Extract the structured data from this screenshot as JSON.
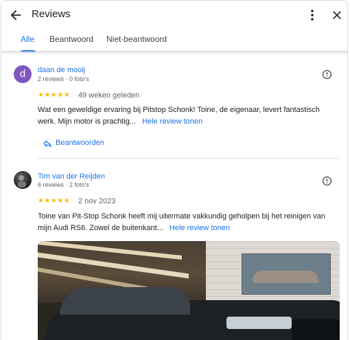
{
  "header": {
    "title": "Reviews",
    "back_icon": "arrow-back-icon",
    "more_icon": "more-vert-icon",
    "close_icon": "close-icon"
  },
  "tabs": [
    {
      "label": "Alle",
      "active": true
    },
    {
      "label": "Beantwoord",
      "active": false
    },
    {
      "label": "Niet-beantwoord",
      "active": false
    }
  ],
  "colors": {
    "accent": "#1a73e8",
    "star": "#fbbc04",
    "avatar_d": "#7e57c2"
  },
  "reviews": [
    {
      "avatar_letter": "d",
      "name": "daan de mooij",
      "meta": "2 reviews · 0 foto's",
      "stars": "★★★★★",
      "rating": 5,
      "date": "49 weken geleden",
      "text": "Wat een geweldige ervaring bij Pitstop Schonk! Toine, de eigenaar, levert fantastisch werk. Mijn motor is prachtig...",
      "more_label": "Hele review tonen",
      "reply_label": "Beantwoorden"
    },
    {
      "name": "Tim van der Reijden",
      "meta": "6 reviews · 2 foto's",
      "stars": "★★★★★",
      "rating": 5,
      "date": "2 nov 2023",
      "text": "Toine van Pit-Stop Schonk heeft mij uitermate vakkundig geholpen bij het reinigen van mijn Audi RS6. Zowel de buitenkant...",
      "more_label": "Hele review tonen"
    }
  ]
}
